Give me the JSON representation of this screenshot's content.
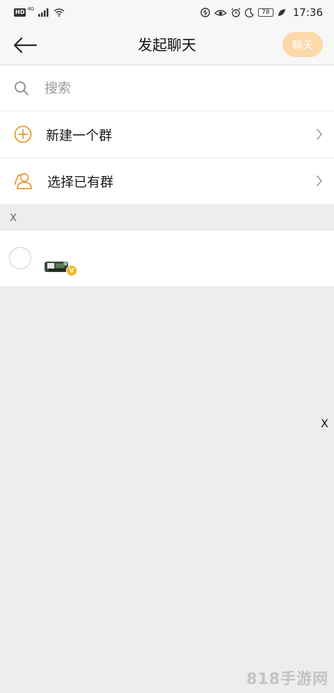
{
  "status_bar": {
    "hd": "HD",
    "network": "4G",
    "battery": "78",
    "time": "17:36"
  },
  "header": {
    "title": "发起聊天",
    "chat_button": "聊天"
  },
  "search": {
    "placeholder": "搜索"
  },
  "menu": {
    "new_group": "新建一个群",
    "choose_group": "选择已有群"
  },
  "section": {
    "letter": "X"
  },
  "contact": {
    "badge": "V"
  },
  "index_bar": {
    "letter": "X"
  },
  "watermark": "818手游网",
  "colors": {
    "accent": "#f0a030",
    "chat_button_disabled": "#fbd9a8",
    "badge": "#f5b21b"
  }
}
